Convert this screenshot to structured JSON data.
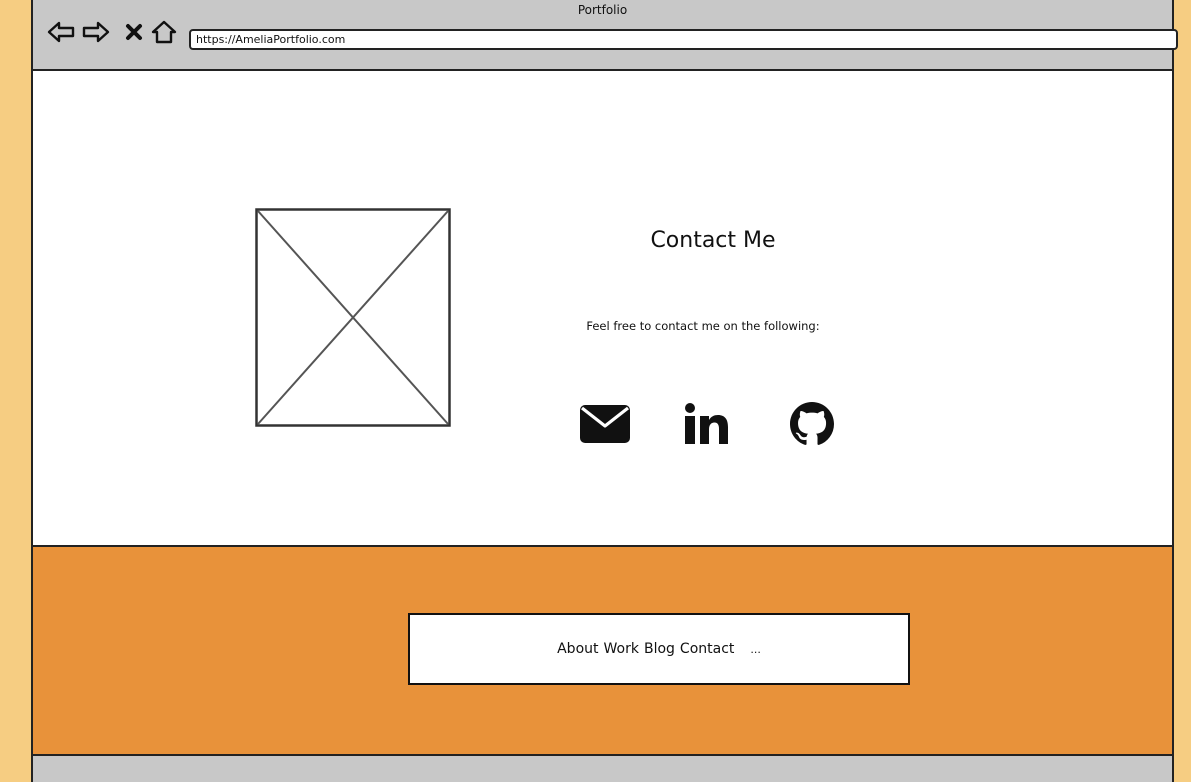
{
  "window": {
    "title": "Portfolio"
  },
  "toolbar": {
    "url": "https://AmeliaPortfolio.com"
  },
  "contact": {
    "title": "Contact Me",
    "description": "Feel free to contact me on the following:",
    "links": [
      "email-icon",
      "linkedin-icon",
      "github-icon"
    ]
  },
  "footer": {
    "nav": [
      {
        "label": "About"
      },
      {
        "label": "Work"
      },
      {
        "label": "Blog"
      },
      {
        "label": "Contact"
      },
      {
        "label": "..."
      }
    ]
  },
  "colors": {
    "page_background": "#f6cd82",
    "browser_chrome": "#c8c8c8",
    "footer_background": "#e8923a"
  }
}
